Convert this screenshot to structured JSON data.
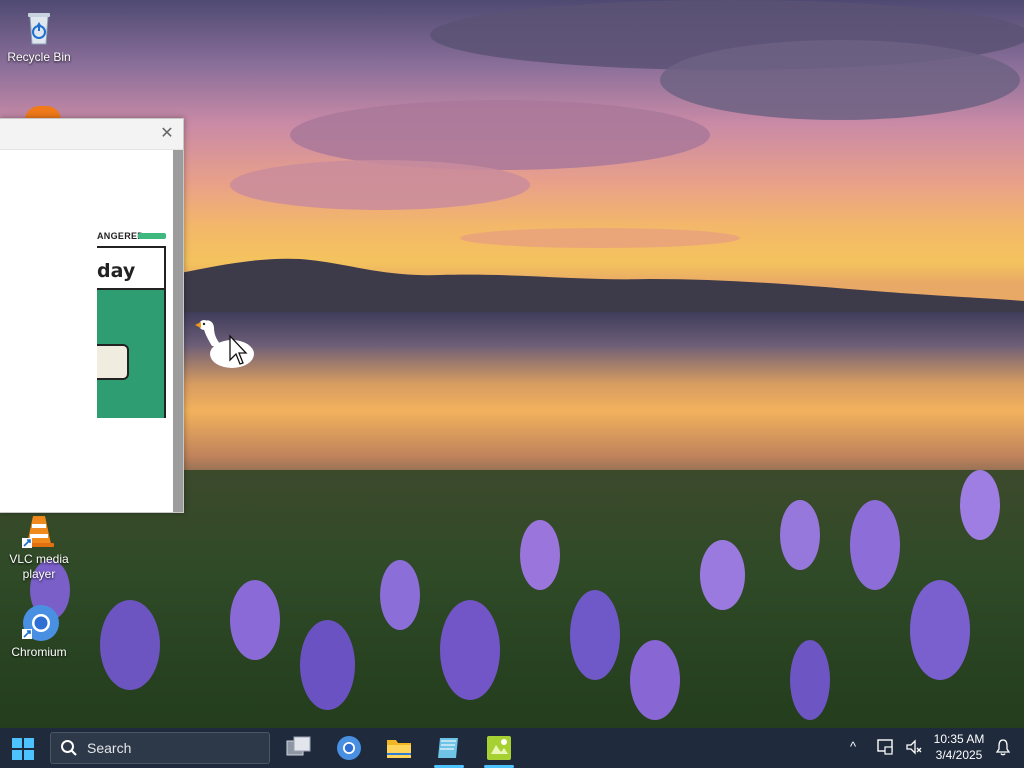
{
  "desktop": {
    "icons": [
      {
        "name": "recycle-bin",
        "label": "Recycle Bin"
      },
      {
        "name": "vlc-media-player",
        "label": "VLC media player"
      },
      {
        "name": "chromium",
        "label": "Chromium"
      }
    ]
  },
  "window": {
    "close_label": "✕",
    "comic_tag": "ANGERED",
    "comic_title": "day"
  },
  "taskbar": {
    "search_placeholder": "Search",
    "pinned": [
      "task-view",
      "chromium",
      "file-explorer",
      "notepad",
      "photo-app"
    ],
    "tray_chevron": "^",
    "time": "10:35 AM",
    "date": "3/4/2025"
  },
  "colors": {
    "taskbar_bg": "#1f2a3c",
    "accent": "#4cc2ff"
  }
}
